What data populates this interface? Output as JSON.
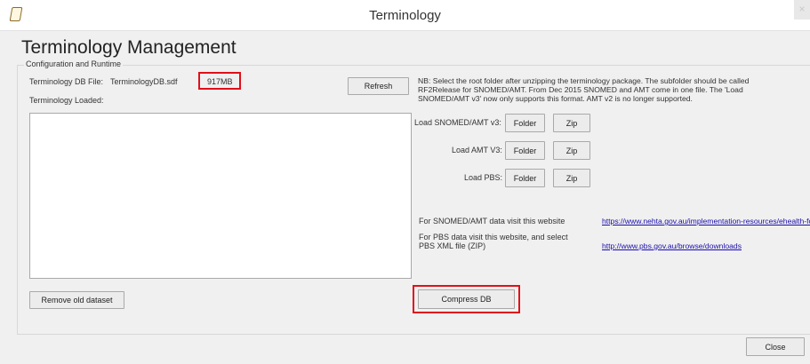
{
  "window": {
    "title": "Terminology",
    "close_glyph": "×"
  },
  "page": {
    "title": "Terminology Management"
  },
  "config_group": {
    "legend": "Configuration and Runtime",
    "db_file_label": "Terminology DB File:",
    "db_file_value": "TerminologyDB.sdf",
    "db_size": "917MB",
    "loaded_label": "Terminology Loaded:",
    "refresh_label": "Refresh",
    "note": "NB: Select the root folder after unzipping the terminology package.  The subfolder should be called RF2Release for SNOMED/AMT. From Dec 2015 SNOMED and AMT come in one file. The 'Load SNOMED/AMT v3' now only supports this format. AMT v2 is no longer supported.",
    "loaders": [
      {
        "label": "Load SNOMED/AMT v3:",
        "folder": "Folder",
        "zip": "Zip"
      },
      {
        "label": "Load AMT V3:",
        "folder": "Folder",
        "zip": "Zip"
      },
      {
        "label": "Load PBS:",
        "folder": "Folder",
        "zip": "Zip"
      }
    ],
    "snomed_visit_text": "For SNOMED/AMT data visit this website",
    "snomed_link": "https://www.nehta.gov.au/implementation-resources/ehealth-fou",
    "pbs_visit_text_1": "For PBS data visit this website, and select",
    "pbs_visit_text_2": "PBS XML file (ZIP)",
    "pbs_link": "http://www.pbs.gov.au/browse/downloads",
    "remove_label": "Remove old dataset",
    "compress_label": "Compress DB"
  },
  "footer": {
    "close_label": "Close"
  },
  "colors": {
    "highlight": "#e0101a",
    "link": "#1a0dab"
  },
  "icons": {
    "app": "document-icon",
    "close": "close-icon"
  }
}
